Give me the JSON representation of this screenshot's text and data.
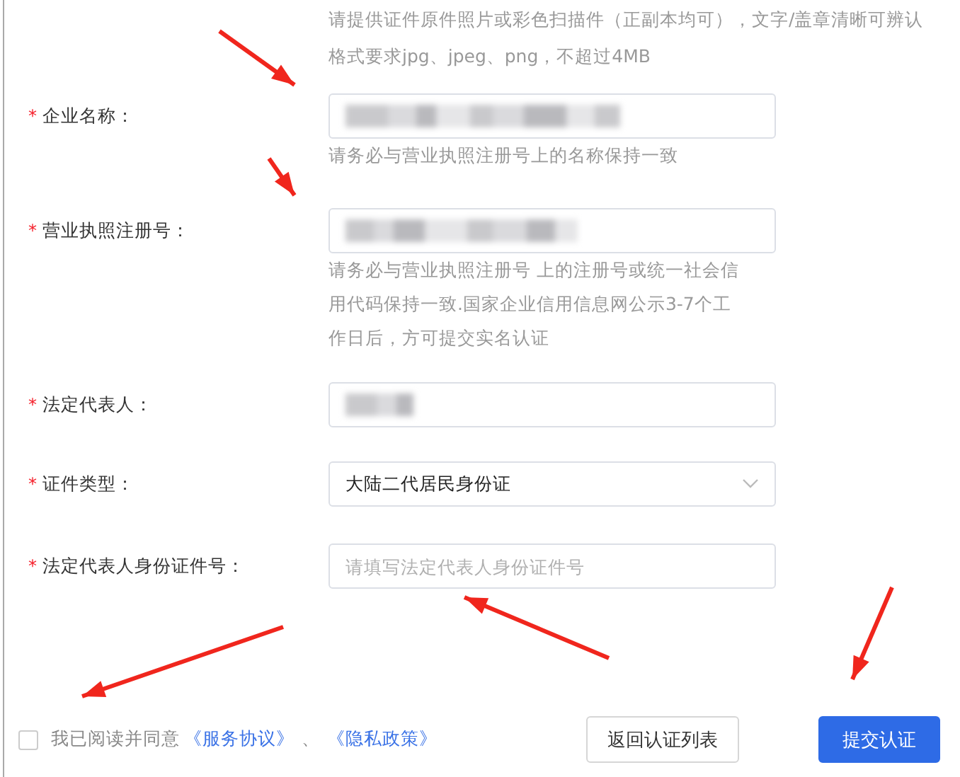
{
  "upload_hint": [
    "请提供证件原件照片或彩色扫描件（正副本均可），文字/盖章清晰可辨认",
    "格式要求jpg、jpeg、png，不超过4MB"
  ],
  "fields": [
    {
      "kind": "input",
      "label": "企业名称：",
      "required_mark": "*",
      "redacted": true,
      "hint": [
        "请务必与营业执照注册号上的名称保持一致"
      ]
    },
    {
      "kind": "input",
      "label": "营业执照注册号：",
      "required_mark": "*",
      "redacted": true,
      "hint": [
        "请务必与营业执照注册号 上的注册号或统一社会信",
        "用代码保持一致.国家企业信用信息网公示3-7个工",
        "作日后，方可提交实名认证"
      ]
    },
    {
      "kind": "input",
      "label": "法定代表人：",
      "required_mark": "*",
      "redacted": true
    },
    {
      "kind": "select",
      "label": "证件类型：",
      "required_mark": "*",
      "value": "大陆二代居民身份证"
    },
    {
      "kind": "input",
      "label": "法定代表人身份证件号：",
      "required_mark": "*",
      "placeholder": "请填写法定代表人身份证件号"
    }
  ],
  "agreement": {
    "checked": false,
    "text": "我已阅读并同意",
    "links": [
      "《服务协议》",
      "《隐私政策》"
    ],
    "separator": "、"
  },
  "buttons": [
    {
      "label": "返回认证列表",
      "kind": "secondary"
    },
    {
      "label": "提交认证",
      "kind": "primary"
    }
  ]
}
